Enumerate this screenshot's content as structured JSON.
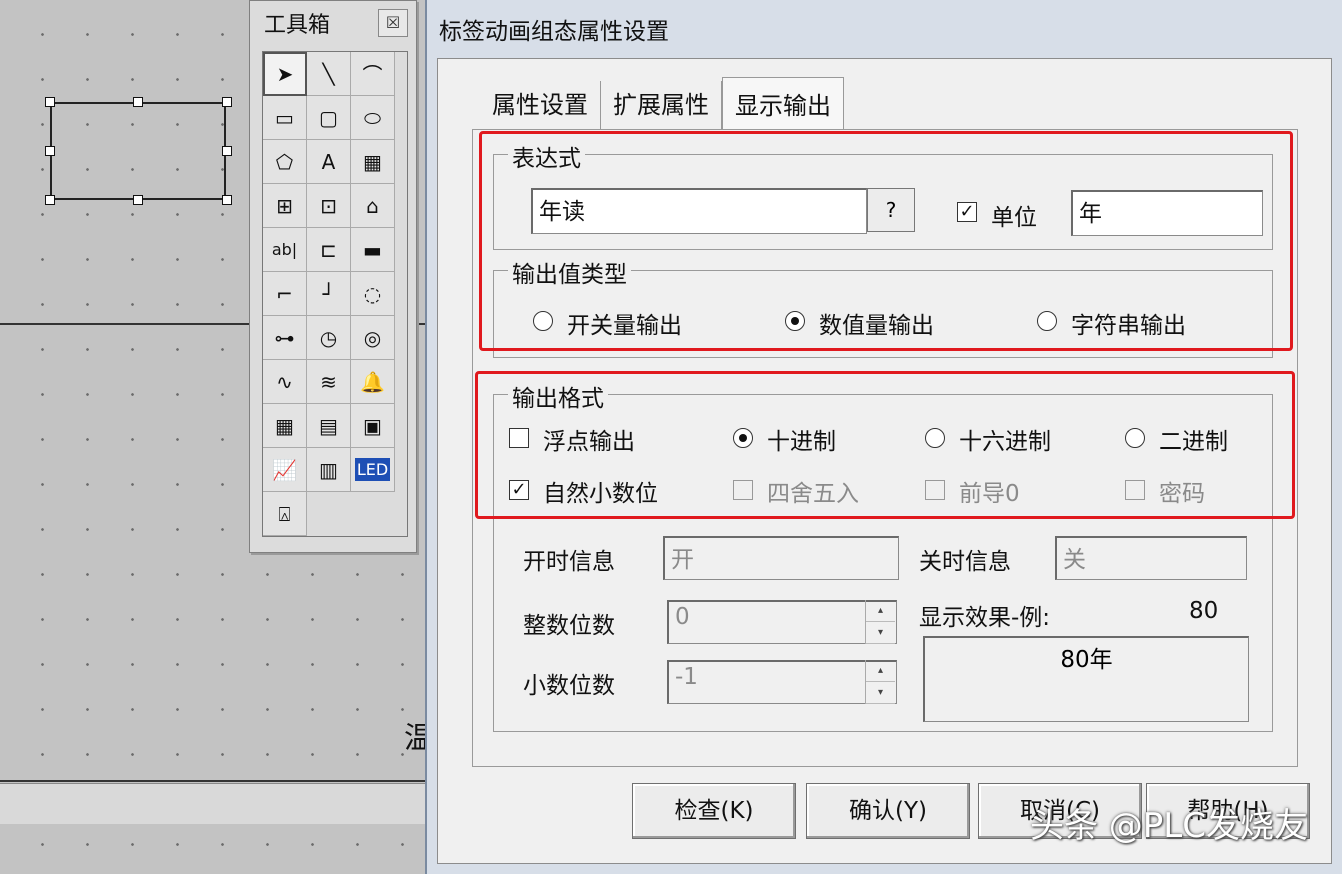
{
  "canvas": {
    "partial_text": "温"
  },
  "toolbox": {
    "title": "工具箱",
    "close_label": "☒",
    "tools": [
      {
        "name": "pointer-tool-icon",
        "glyph": "➤"
      },
      {
        "name": "line-tool-icon",
        "glyph": "╲"
      },
      {
        "name": "arc-tool-icon",
        "glyph": "⌒"
      },
      {
        "name": "rectangle-tool-icon",
        "glyph": "▭"
      },
      {
        "name": "rounded-rect-tool-icon",
        "glyph": "▢"
      },
      {
        "name": "ellipse-tool-icon",
        "glyph": "⬭"
      },
      {
        "name": "polygon-tool-icon",
        "glyph": "⬠"
      },
      {
        "name": "text-tool-icon",
        "glyph": "A"
      },
      {
        "name": "bitmap-tool-icon",
        "glyph": "▦"
      },
      {
        "name": "symbol-lib-tool-icon",
        "glyph": "⊞"
      },
      {
        "name": "symbol-lib2-tool-icon",
        "glyph": "⊡"
      },
      {
        "name": "home-tool-icon",
        "glyph": "⌂"
      },
      {
        "name": "input-box-tool-icon",
        "glyph": "ab|"
      },
      {
        "name": "slider-tool-icon",
        "glyph": "⊏"
      },
      {
        "name": "animation-button-tool-icon",
        "glyph": "▬"
      },
      {
        "name": "flow-line-tool-icon",
        "glyph": "⌐"
      },
      {
        "name": "step-line-tool-icon",
        "glyph": "┘"
      },
      {
        "name": "ring-tool-icon",
        "glyph": "◌"
      },
      {
        "name": "pipe-tool-icon",
        "glyph": "⊶"
      },
      {
        "name": "gauge-tool-icon",
        "glyph": "◷"
      },
      {
        "name": "rotate-tool-icon",
        "glyph": "◎"
      },
      {
        "name": "trend-chart-tool-icon",
        "glyph": "∿"
      },
      {
        "name": "history-curve-tool-icon",
        "glyph": "≋"
      },
      {
        "name": "alarm-tool-icon",
        "glyph": "🔔"
      },
      {
        "name": "table-tool-icon",
        "glyph": "▦"
      },
      {
        "name": "report-tool-icon",
        "glyph": "▤"
      },
      {
        "name": "storage-tool-icon",
        "glyph": "▣"
      },
      {
        "name": "purple-chart-tool-icon",
        "glyph": "📈"
      },
      {
        "name": "form-tool-icon",
        "glyph": "▥"
      },
      {
        "name": "led-tool-icon",
        "glyph": "LED"
      },
      {
        "name": "alarm-bell-tool-icon",
        "glyph": "⍓"
      }
    ]
  },
  "dialog": {
    "title": "标签动画组态属性设置",
    "tabs": [
      "属性设置",
      "扩展属性",
      "显示输出"
    ],
    "expression": {
      "group_label": "表达式",
      "value": "年读",
      "help_button": "?",
      "unit_checked": true,
      "unit_label": "单位",
      "unit_value": "年"
    },
    "output_type": {
      "group_label": "输出值类型",
      "options": [
        "开关量输出",
        "数值量输出",
        "字符串输出"
      ],
      "selected": "数值量输出"
    },
    "output_format": {
      "group_label": "输出格式",
      "float_label": "浮点输出",
      "float_checked": false,
      "bases": [
        "十进制",
        "十六进制",
        "二进制"
      ],
      "selected_base": "十进制",
      "natural_decimal_label": "自然小数位",
      "natural_decimal_checked": true,
      "round_label": "四舍五入",
      "leading_zero_label": "前导0",
      "password_label": "密码"
    },
    "on_info": {
      "label": "开时信息",
      "value": "开"
    },
    "off_info": {
      "label": "关时信息",
      "value": "关"
    },
    "int_digits": {
      "label": "整数位数",
      "value": "0"
    },
    "dec_digits": {
      "label": "小数位数",
      "value": "-1"
    },
    "preview": {
      "label": "显示效果-例:",
      "example_value": "80",
      "result": "80年"
    },
    "buttons": {
      "check": "检查(K)",
      "confirm": "确认(Y)",
      "cancel": "取消(C)",
      "help": "帮助(H)"
    }
  },
  "watermark": "头条 @PLC发烧友"
}
